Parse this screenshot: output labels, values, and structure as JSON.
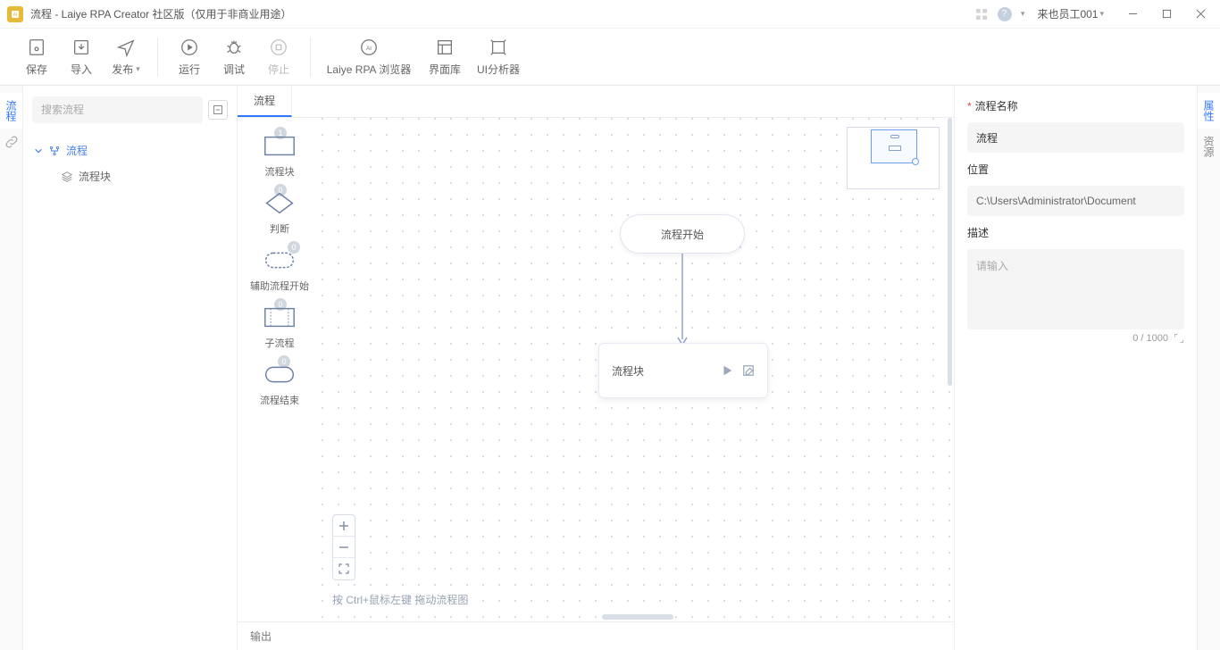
{
  "titlebar": {
    "title": "流程 - Laiye RPA Creator 社区版（仅用于非商业用途）",
    "user": "来也员工001"
  },
  "toolbar": {
    "save": "保存",
    "import": "导入",
    "publish": "发布",
    "run": "运行",
    "debug": "调试",
    "stop": "停止",
    "browser": "Laiye RPA 浏览器",
    "ui_lib": "界面库",
    "ui_analyzer": "UI分析器"
  },
  "left_tabs": {
    "flow": "流程"
  },
  "tree": {
    "search_placeholder": "搜索流程",
    "root": "流程",
    "child": "流程块"
  },
  "editor": {
    "tab": "流程",
    "palette": [
      {
        "label": "流程块",
        "badge": "1"
      },
      {
        "label": "判断",
        "badge": "0"
      },
      {
        "label": "辅助流程开始",
        "badge": "0"
      },
      {
        "label": "子流程",
        "badge": "0"
      },
      {
        "label": "流程结束",
        "badge": "0"
      }
    ],
    "node_start": "流程开始",
    "node_block": "流程块",
    "hint": "按 Ctrl+鼠标左键 拖动流程图"
  },
  "right_tabs": {
    "prop": "属性",
    "resource": "资源"
  },
  "props": {
    "name_label": "流程名称",
    "name_value": "流程",
    "path_label": "位置",
    "path_value": "C:\\Users\\Administrator\\Document",
    "desc_label": "描述",
    "desc_placeholder": "请输入",
    "counter": "0 / 1000"
  },
  "output": {
    "label": "输出"
  }
}
